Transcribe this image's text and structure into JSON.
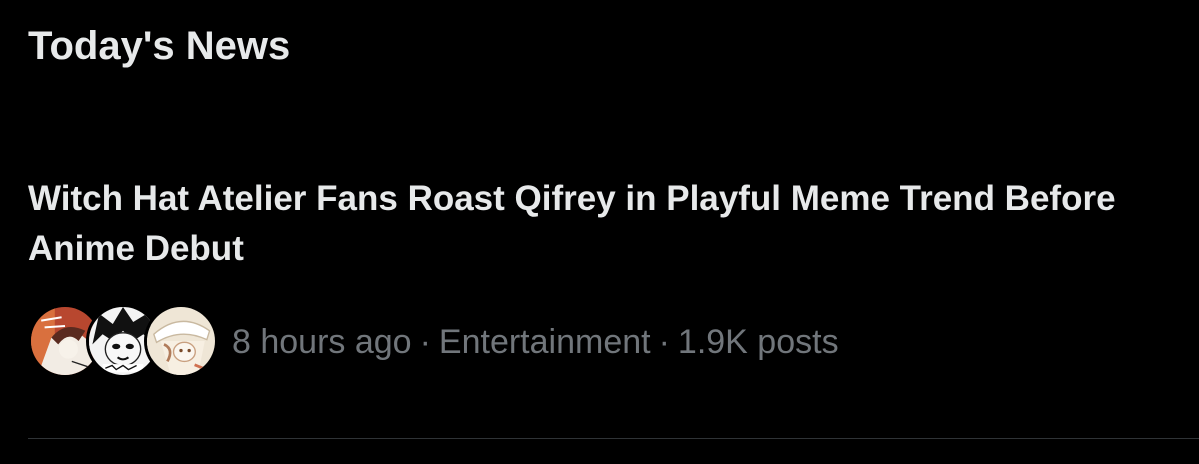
{
  "section": {
    "title": "Today's News"
  },
  "news_item": {
    "headline": "Witch Hat Atelier Fans Roast Qifrey in Playful Meme Trend Before Anime Debut",
    "time": "8 hours ago",
    "category": "Entertainment",
    "posts": "1.9K posts",
    "separator": "·",
    "avatars": [
      {
        "icon": "anime-character-avatar-red"
      },
      {
        "icon": "anime-character-avatar-dark-hair"
      },
      {
        "icon": "anime-character-avatar-white-hat"
      }
    ]
  },
  "colors": {
    "background": "#000000",
    "primary_text": "#e7e9ea",
    "secondary_text": "#71767b",
    "divider": "#2f3336"
  }
}
